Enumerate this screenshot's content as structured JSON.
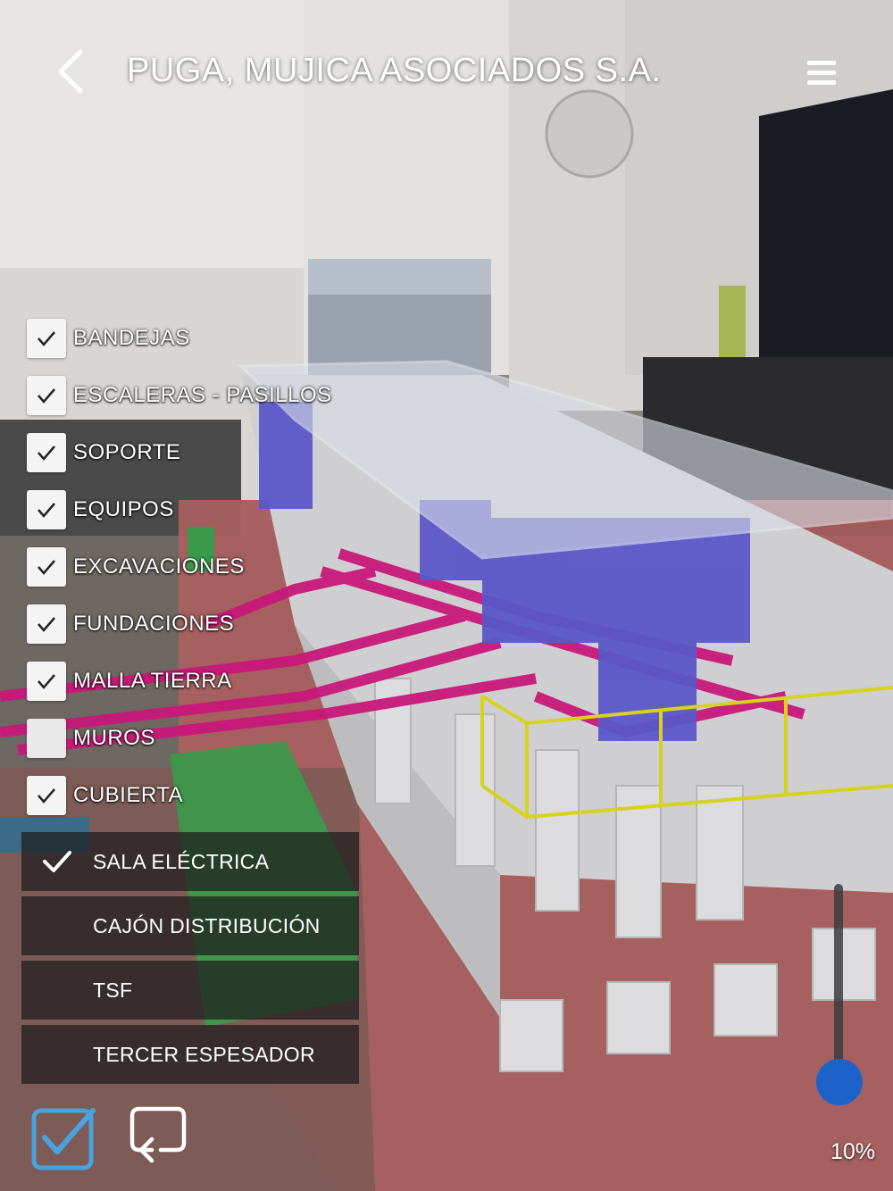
{
  "header": {
    "title": "PUGA, MUJICA ASOCIADOS S.A.",
    "back_icon": "chevron-left-icon",
    "menu_icon": "hamburger-menu-icon"
  },
  "layers": [
    {
      "label": "BANDEJAS",
      "checked": true
    },
    {
      "label": "ESCALERAS - PASILLOS",
      "checked": true
    },
    {
      "label": "SOPORTE",
      "checked": true
    },
    {
      "label": "EQUIPOS",
      "checked": true
    },
    {
      "label": "EXCAVACIONES",
      "checked": true
    },
    {
      "label": "FUNDACIONES",
      "checked": true
    },
    {
      "label": "MALLA TIERRA",
      "checked": true
    },
    {
      "label": "MUROS",
      "checked": false
    },
    {
      "label": "CUBIERTA",
      "checked": true
    }
  ],
  "projects": [
    {
      "label": "SALA ELÉCTRICA",
      "selected": true
    },
    {
      "label": "CAJÓN DISTRIBUCIÓN",
      "selected": false
    },
    {
      "label": "TSF",
      "selected": false
    },
    {
      "label": "TERCER ESPESADOR",
      "selected": false
    }
  ],
  "bottom": {
    "check_icon": "checkbox-checked-icon",
    "rotate_icon": "rotate-reset-icon"
  },
  "opacity": {
    "value_label": "10%",
    "value": 0.1
  },
  "colors": {
    "accent_blue": "#1b63c9",
    "icon_blue": "#4aa3dc",
    "equipment_purple": "#5b57c8",
    "trays_magenta": "#c8187a",
    "rail_yellow": "#d6d21e",
    "equipment_green": "#3a9a4a"
  }
}
